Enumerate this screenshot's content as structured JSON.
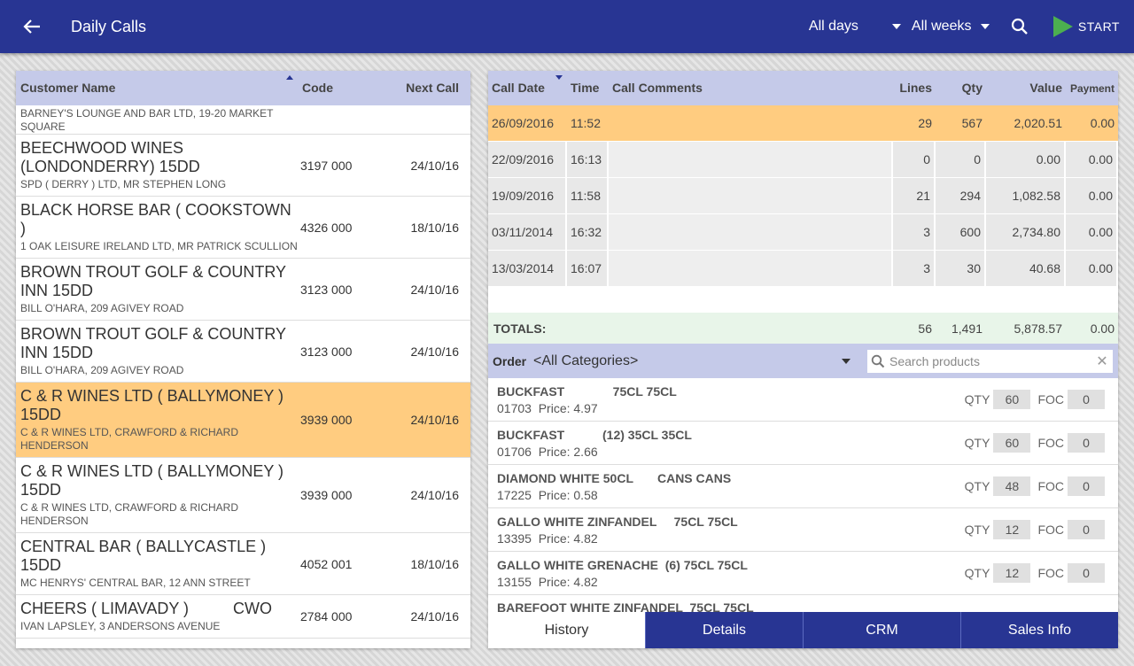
{
  "header": {
    "title": "Daily Calls",
    "days_filter": "All days",
    "weeks_filter": "All weeks",
    "start_label": "START",
    "colors": {
      "bar": "#283593",
      "start_icon": "#4caf50"
    }
  },
  "customers": {
    "columns": {
      "name": "Customer Name",
      "code": "Code",
      "next_call": "Next Call"
    },
    "rows": [
      {
        "name": "",
        "address": "BARNEY'S LOUNGE AND BAR LTD, 19-20 MARKET SQUARE",
        "code": "",
        "next": ""
      },
      {
        "name": "BEECHWOOD WINES (LONDONDERRY) 15DD",
        "address": "SPD ( DERRY ) LTD, MR STEPHEN LONG",
        "code": "3197 000",
        "next": "24/10/16"
      },
      {
        "name": "BLACK HORSE BAR ( COOKSTOWN )",
        "address": "1 OAK LEISURE IRELAND LTD, MR PATRICK SCULLION",
        "code": "4326 000",
        "next": "18/10/16"
      },
      {
        "name": "BROWN TROUT GOLF & COUNTRY INN 15DD",
        "address": "BILL O'HARA, 209 AGIVEY ROAD",
        "code": "3123 000",
        "next": "24/10/16"
      },
      {
        "name": "BROWN TROUT GOLF & COUNTRY INN 15DD",
        "address": "BILL O'HARA, 209 AGIVEY ROAD",
        "code": "3123 000",
        "next": "24/10/16"
      },
      {
        "name": "C & R WINES LTD ( BALLYMONEY ) 15DD",
        "address": "C & R WINES LTD, CRAWFORD & RICHARD HENDERSON",
        "code": "3939 000",
        "next": "24/10/16",
        "selected": true
      },
      {
        "name": "C & R WINES LTD ( BALLYMONEY ) 15DD",
        "address": "C & R WINES LTD, CRAWFORD & RICHARD HENDERSON",
        "code": "3939 000",
        "next": "24/10/16"
      },
      {
        "name": "CENTRAL BAR ( BALLYCASTLE ) 15DD",
        "address": "MC HENRYS' CENTRAL BAR, 12 ANN STREET",
        "code": "4052 001",
        "next": "18/10/16"
      },
      {
        "name": "CHEERS ( LIMAVADY )          CWO",
        "address": "IVAN LAPSLEY, 3 ANDERSONS AVENUE",
        "code": "2784 000",
        "next": "24/10/16"
      }
    ]
  },
  "history": {
    "columns": {
      "date": "Call Date",
      "time": "Time",
      "comments": "Call Comments",
      "lines": "Lines",
      "qty": "Qty",
      "value": "Value",
      "payment": "Payment"
    },
    "rows": [
      {
        "date": "26/09/2016",
        "time": "11:52",
        "comments": "",
        "lines": "29",
        "qty": "567",
        "value": "2,020.51",
        "payment": "0.00",
        "selected": true
      },
      {
        "date": "22/09/2016",
        "time": "16:13",
        "comments": "",
        "lines": "0",
        "qty": "0",
        "value": "0.00",
        "payment": "0.00"
      },
      {
        "date": "19/09/2016",
        "time": "11:58",
        "comments": "",
        "lines": "21",
        "qty": "294",
        "value": "1,082.58",
        "payment": "0.00"
      },
      {
        "date": "03/11/2014",
        "time": "16:32",
        "comments": "",
        "lines": "3",
        "qty": "600",
        "value": "2,734.80",
        "payment": "0.00"
      },
      {
        "date": "13/03/2014",
        "time": "16:07",
        "comments": "",
        "lines": "3",
        "qty": "30",
        "value": "40.68",
        "payment": "0.00"
      }
    ],
    "totals": {
      "label": "TOTALS:",
      "lines": "56",
      "qty": "1,491",
      "value": "5,878.57",
      "payment": "0.00"
    }
  },
  "order": {
    "label": "Order",
    "category": "<All Categories>",
    "search_placeholder": "Search products",
    "qty_label": "QTY",
    "foc_label": "FOC",
    "products": [
      {
        "name": "BUCKFAST              75CL 75CL",
        "code": "01703",
        "price": "Price: 4.97",
        "qty": "60",
        "foc": "0"
      },
      {
        "name": "BUCKFAST           (12) 35CL 35CL",
        "code": "01706",
        "price": "Price: 2.66",
        "qty": "60",
        "foc": "0"
      },
      {
        "name": "DIAMOND WHITE 50CL       CANS CANS",
        "code": "17225",
        "price": "Price: 0.58",
        "qty": "48",
        "foc": "0"
      },
      {
        "name": "GALLO WHITE ZINFANDEL     75CL 75CL",
        "code": "13395",
        "price": "Price: 4.82",
        "qty": "12",
        "foc": "0"
      },
      {
        "name": "GALLO WHITE GRENACHE  (6) 75CL 75CL",
        "code": "13155",
        "price": "Price: 4.82",
        "qty": "12",
        "foc": "0"
      },
      {
        "name": "BAREFOOT WHITE ZINFANDEL  75CL 75CL",
        "code": "",
        "price": "",
        "qty": "",
        "foc": ""
      }
    ]
  },
  "tabs": [
    {
      "label": "History",
      "active": true
    },
    {
      "label": "Details"
    },
    {
      "label": "CRM"
    },
    {
      "label": "Sales Info"
    }
  ]
}
